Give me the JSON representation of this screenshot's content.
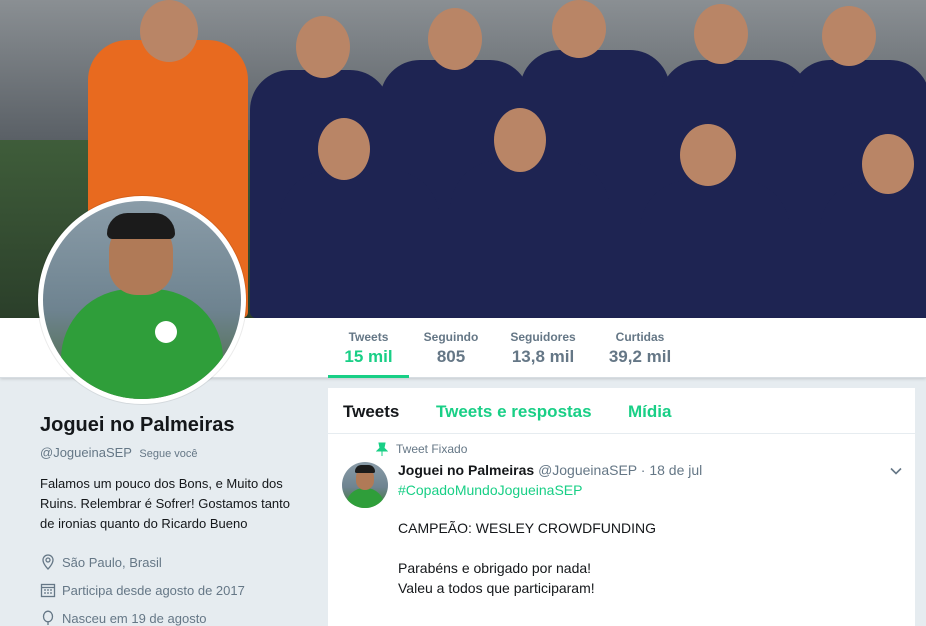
{
  "stats": [
    {
      "label": "Tweets",
      "value": "15 mil",
      "active": true
    },
    {
      "label": "Seguindo",
      "value": "805"
    },
    {
      "label": "Seguidores",
      "value": "13,8 mil"
    },
    {
      "label": "Curtidas",
      "value": "39,2 mil"
    }
  ],
  "profile": {
    "name": "Joguei no Palmeiras",
    "handle": "@JogueinaSEP",
    "follows_you": "Segue você",
    "bio": "Falamos um pouco dos Bons, e Muito dos Ruins. Relembrar é Sofrer! Gostamos tanto de ironias quanto do Ricardo Bueno",
    "location": "São Paulo, Brasil",
    "joined": "Participa desde agosto de 2017",
    "birthday": "Nasceu em 19 de agosto"
  },
  "tabs": [
    {
      "label": "Tweets",
      "active": true
    },
    {
      "label": "Tweets e respostas"
    },
    {
      "label": "Mídia"
    }
  ],
  "tweet": {
    "pinned_label": "Tweet Fixado",
    "author_name": "Joguei no Palmeiras",
    "author_handle": "@JogueinaSEP",
    "date": "· 18 de jul",
    "hashtag": "#CopadoMundoJogueinaSEP",
    "lines": [
      "CAMPEÃO:  WESLEY CROWDFUNDING",
      "Parabéns e obrigado por nada!",
      "Valeu a todos que participaram!"
    ]
  },
  "colors": {
    "accent": "#19cf86",
    "text": "#14171a",
    "muted": "#657786",
    "background": "#e6ecf0"
  }
}
